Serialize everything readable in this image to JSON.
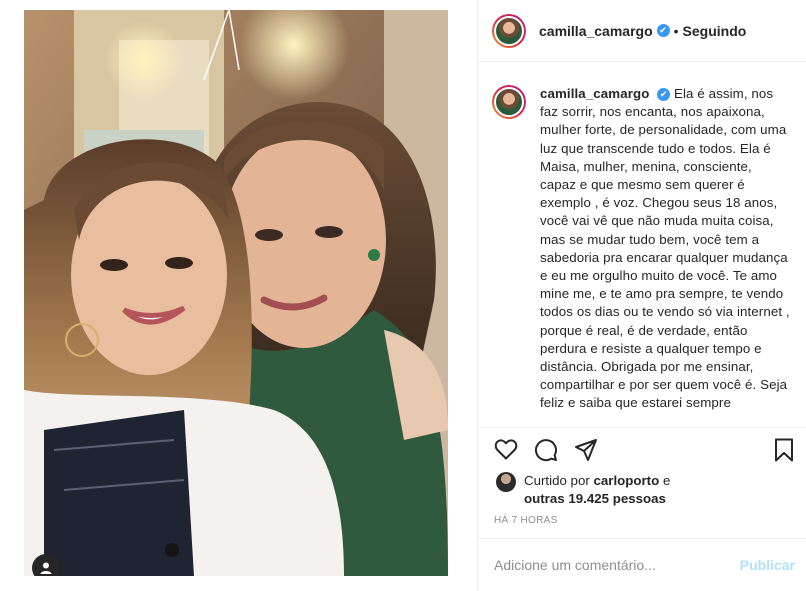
{
  "post": {
    "username": "camilla_camargo",
    "verified_badge": "✔",
    "separator": "•",
    "follow_state": "Seguindo",
    "caption": "Ela é assim, nos faz sorrir, nos encanta, nos apaixona, mulher forte, de personalidade, com uma luz que transcende tudo e todos. Ela é Maisa, mulher, menina, consciente, capaz e que mesmo sem querer é exemplo , é voz. Chegou seus 18 anos, você vai vê que não muda muita coisa, mas se mudar tudo bem, você tem a sabedoria pra encarar qualquer mudança e eu me orgulho muito de você. Te amo mine me, e te amo pra sempre, te vendo todos os dias ou te vendo só via internet , porque é real, é de verdade, então perdura e resiste a qualquer tempo e distância. Obrigada por me ensinar, compartilhar e por ser quem você é. Seja feliz e saiba que estarei sempre",
    "likes": {
      "prefix": "Curtido por",
      "user": "carloporto",
      "connector": "e",
      "others": "outras 19.425 pessoas"
    },
    "timestamp": "HÁ 7 HORAS",
    "comment_placeholder": "Adicione um comentário...",
    "publish_label": "Publicar"
  },
  "icons": {
    "like": "heart-icon",
    "comment": "comment-icon",
    "share": "share-icon",
    "save": "bookmark-icon",
    "tagged": "user-tag-icon"
  },
  "colors": {
    "text": "#262626",
    "muted": "#8e8e8e",
    "verified": "#3897f0",
    "publish_disabled": "#b2dffc",
    "border": "#efefef"
  }
}
